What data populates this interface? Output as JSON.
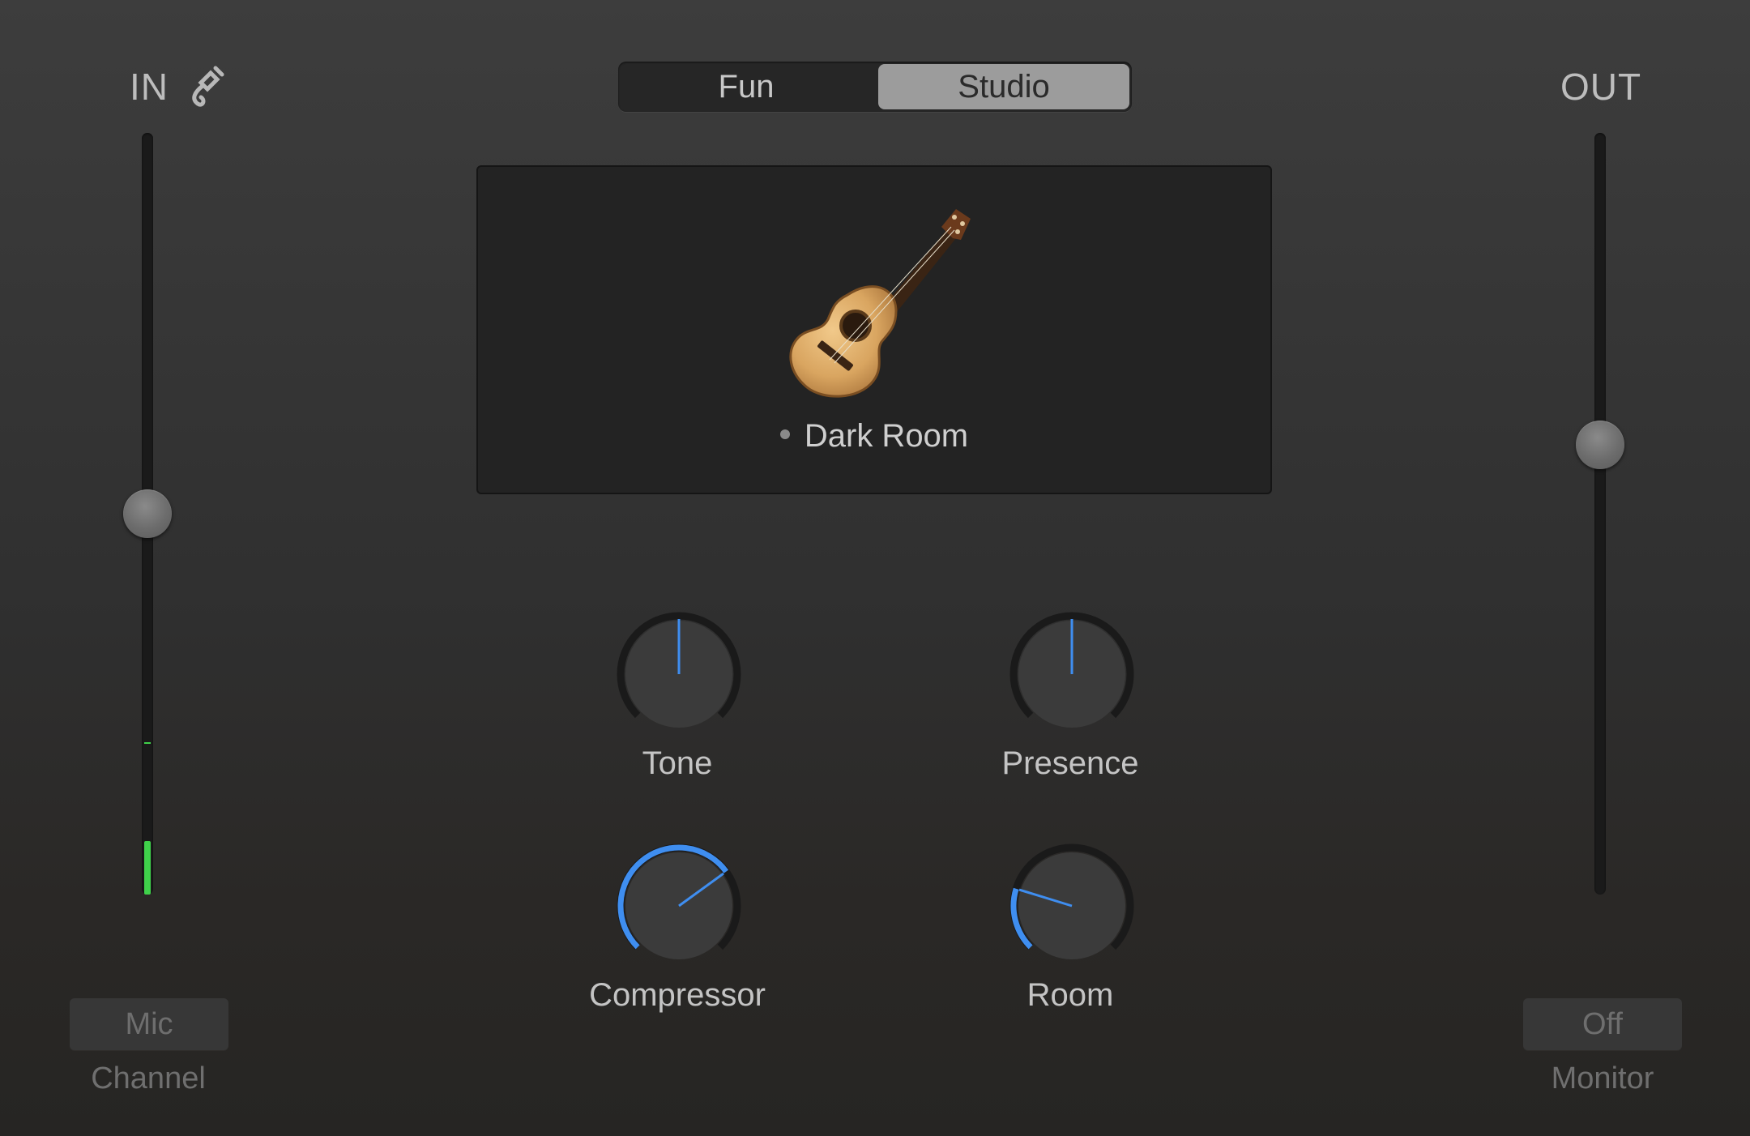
{
  "input": {
    "label": "IN",
    "jack_icon": "cable-jack-icon",
    "fader_level": 0.5,
    "meter_level": 0.07,
    "meter_peak": 0.2,
    "channel_button": "Mic",
    "channel_label": "Channel"
  },
  "output": {
    "label": "OUT",
    "fader_level": 0.59,
    "monitor_button": "Off",
    "monitor_label": "Monitor"
  },
  "mode_switch": {
    "options": [
      "Fun",
      "Studio"
    ],
    "selected": "Studio"
  },
  "preset": {
    "icon": "acoustic-guitar-icon",
    "name": "Dark Room"
  },
  "knobs": [
    {
      "label": "Tone",
      "value": 0.5
    },
    {
      "label": "Presence",
      "value": 0.5
    },
    {
      "label": "Compressor",
      "value": 0.7
    },
    {
      "label": "Room",
      "value": 0.23
    }
  ],
  "colors": {
    "accent_blue": "#3f8ef0",
    "meter_green": "#3fd14a"
  }
}
